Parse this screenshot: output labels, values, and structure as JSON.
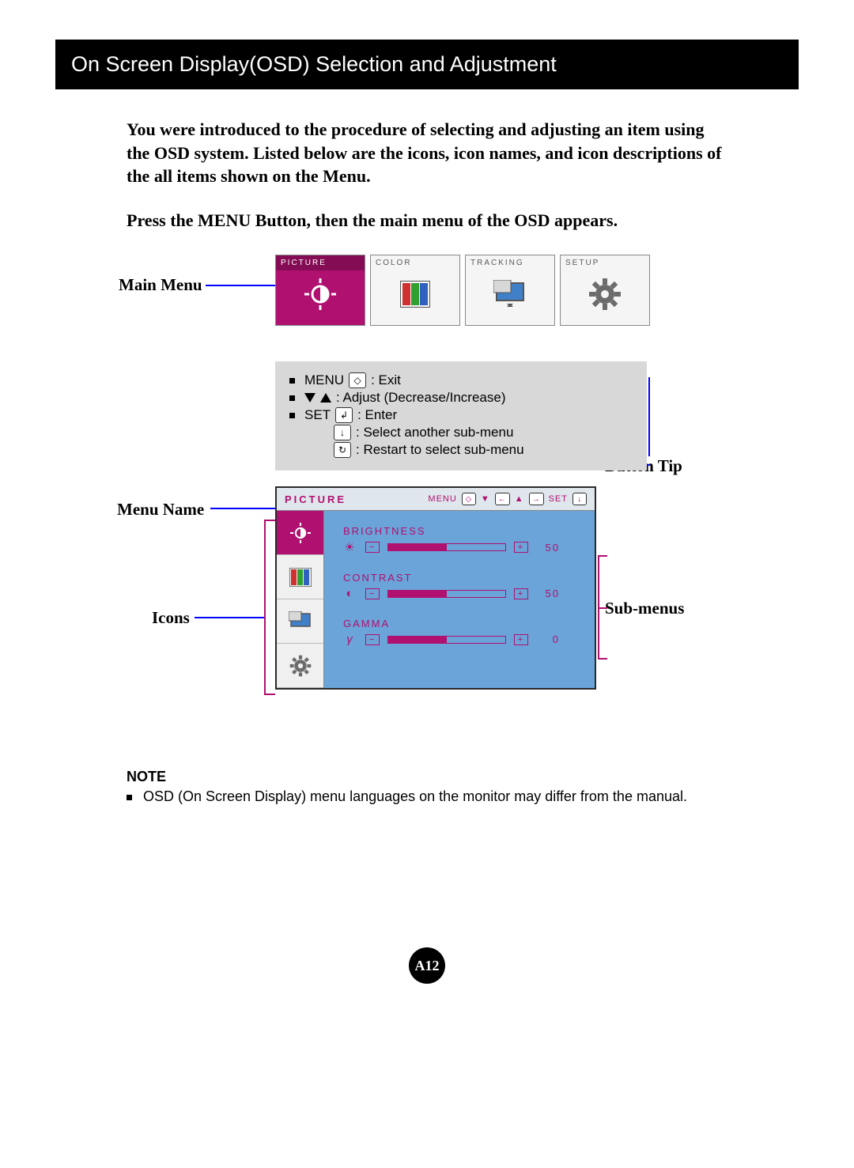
{
  "header": {
    "title": "On Screen Display(OSD) Selection and Adjustment"
  },
  "intro": {
    "p1": "You were introduced to the procedure of selecting and adjusting an item using the OSD system.  Listed below are the icons, icon names, and icon descriptions of the all items shown on the Menu.",
    "p2": "Press the MENU Button, then the main menu of the OSD appears."
  },
  "labels": {
    "main_menu": "Main Menu",
    "button_tip": "Button Tip",
    "menu_name": "Menu Name",
    "icons": "Icons",
    "submenus": "Sub-menus"
  },
  "tabs": [
    {
      "label": "PICTURE",
      "icon": "brightness-icon",
      "active": true
    },
    {
      "label": "COLOR",
      "icon": "color-bars-icon",
      "active": false
    },
    {
      "label": "TRACKING",
      "icon": "tracking-icon",
      "active": false
    },
    {
      "label": "SETUP",
      "icon": "gear-icon",
      "active": false
    }
  ],
  "tips": {
    "rows": [
      {
        "prefix": "MENU",
        "key": "diamond",
        "text": ": Exit"
      },
      {
        "prefix": "",
        "key": "down-up",
        "text": ": Adjust (Decrease/Increase)"
      },
      {
        "prefix": "SET",
        "key": "enter",
        "text": ": Enter"
      },
      {
        "prefix": "",
        "key": "down-arrow",
        "text": ": Select another sub-menu"
      },
      {
        "prefix": "",
        "key": "circle-arrow",
        "text": ": Restart to select sub-menu"
      }
    ]
  },
  "osd": {
    "title": "PICTURE",
    "hints": {
      "menu": "MENU",
      "set": "SET"
    },
    "icons": [
      {
        "name": "brightness-icon",
        "active": true
      },
      {
        "name": "color-bars-icon",
        "active": false
      },
      {
        "name": "tracking-icon",
        "active": false
      },
      {
        "name": "gear-icon",
        "active": false
      }
    ],
    "sliders": [
      {
        "name": "BRIGHTNESS",
        "symbol": "sun",
        "value": 50,
        "fill": 50
      },
      {
        "name": "CONTRAST",
        "symbol": "contrast",
        "value": 50,
        "fill": 50
      },
      {
        "name": "GAMMA",
        "symbol": "gamma",
        "value": 0,
        "fill": 50
      }
    ]
  },
  "note": {
    "title": "NOTE",
    "body": "OSD (On Screen Display) menu languages on the monitor may differ from the manual."
  },
  "page_number": "A12"
}
